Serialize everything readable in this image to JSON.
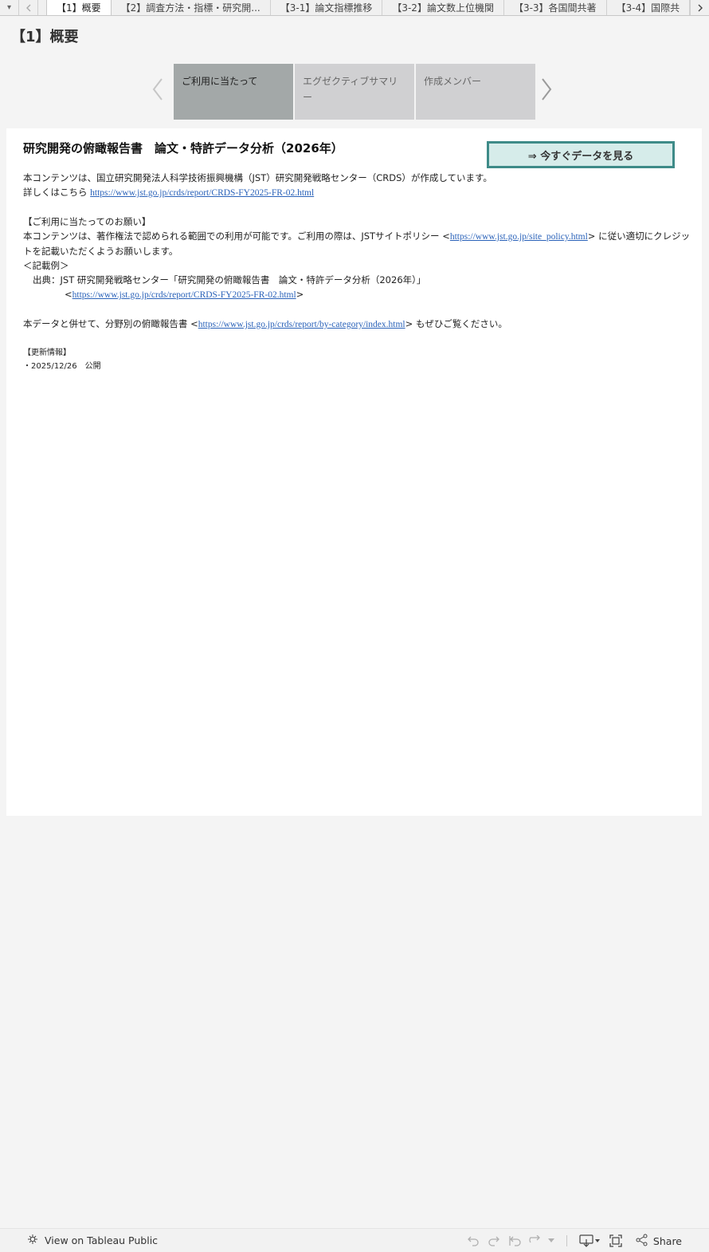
{
  "tabs": {
    "menu_icon": "▾",
    "items": [
      "【1】概要",
      "【2】調査方法・指標・研究開...",
      "【3-1】論文指標推移",
      "【3-2】論文数上位機関",
      "【3-3】各国間共著",
      "【3-4】国際共"
    ]
  },
  "page": {
    "title": "【1】概要"
  },
  "subnav": {
    "items": [
      "ご利用に当たって",
      "エグゼクティブサマリー",
      "作成メンバー"
    ]
  },
  "content": {
    "title": "研究開発の俯瞰報告書　論文・特許データ分析（2026年）",
    "cta_label": "⇒ 今すぐデータを見る",
    "intro_line1": "本コンテンツは、国立研究開発法人科学技術振興機構（JST）研究開発戦略センター（CRDS）が作成しています。",
    "intro_line2_prefix": "詳しくはこちら ",
    "report_url": "https://www.jst.go.jp/crds/report/CRDS-FY2025-FR-02.html",
    "request_heading": "【ご利用に当たってのお願い】",
    "request_text_prefix": "本コンテンツは、著作権法で認められる範囲での利用が可能です。ご利用の際は、JSTサイトポリシー <",
    "site_policy_url": "https://www.jst.go.jp/site_policy.html",
    "request_text_suffix": "> に従い適切にクレジットを記載いただくようお願いします。",
    "example_heading": "＜記載例＞",
    "citation_line": "出典：JST 研究開発戦略センター「研究開発の俯瞰報告書　論文・特許データ分析（2026年）」",
    "citation_url": "https://www.jst.go.jp/crds/report/CRDS-FY2025-FR-02.html",
    "category_prefix": "本データと併せて、分野別の俯瞰報告書 <",
    "category_url": "https://www.jst.go.jp/crds/report/by-category/index.html",
    "category_suffix": "> もぜひご覧ください。",
    "update_heading": "【更新情報】",
    "update_item": "・2025/12/26　公開"
  },
  "footer": {
    "view_label": "View on Tableau Public",
    "share_label": "Share"
  },
  "colors": {
    "cta_background": "#d6ecea",
    "cta_border": "#3e8b88",
    "active_subnav": "#a3a8a8",
    "inactive_subnav": "#d0d0d2",
    "link": "#2a62b9"
  }
}
